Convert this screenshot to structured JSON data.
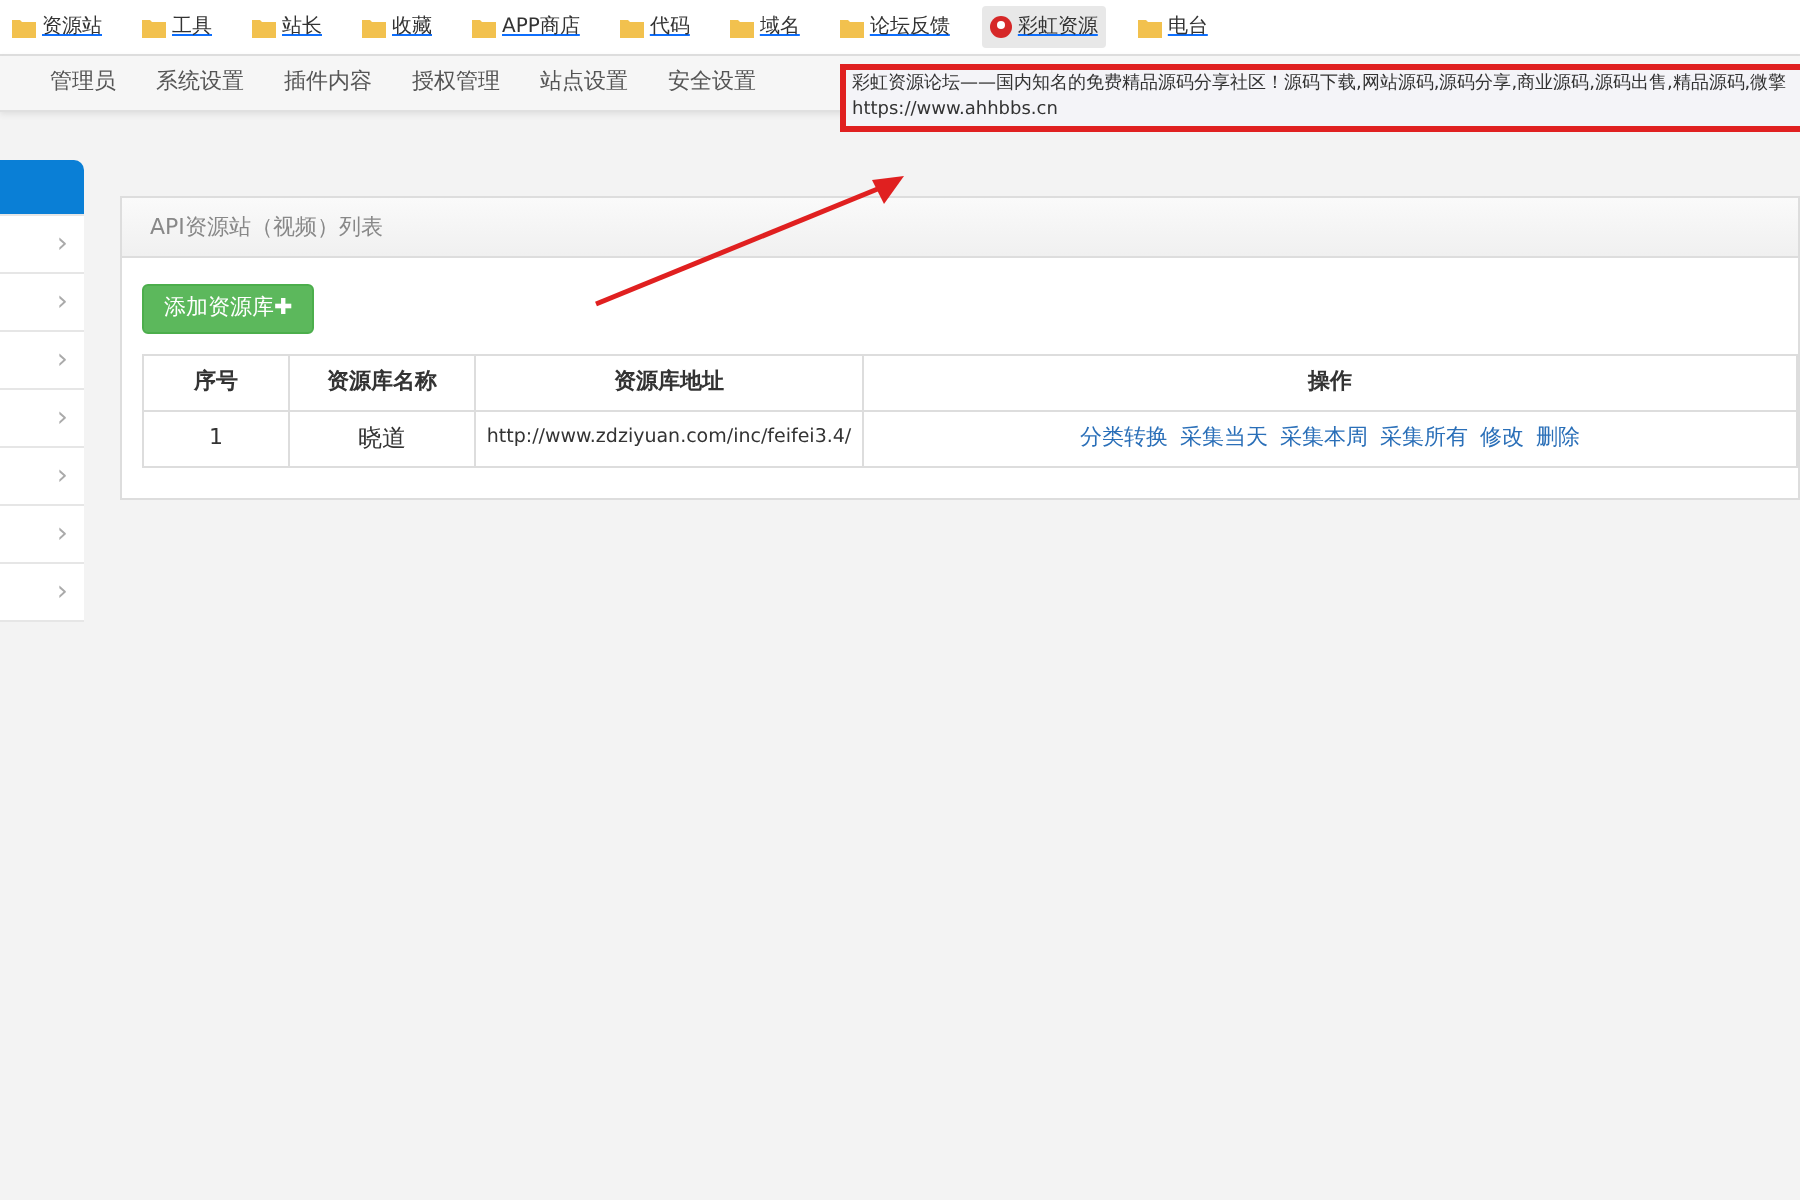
{
  "bookmarks": [
    {
      "kind": "folder",
      "label": "资源站"
    },
    {
      "kind": "folder",
      "label": "工具"
    },
    {
      "kind": "folder",
      "label": "站长"
    },
    {
      "kind": "folder",
      "label": "收藏"
    },
    {
      "kind": "folder",
      "label": "APP商店"
    },
    {
      "kind": "folder",
      "label": "代码"
    },
    {
      "kind": "folder",
      "label": "域名"
    },
    {
      "kind": "folder",
      "label": "论坛反馈"
    },
    {
      "kind": "site",
      "label": "彩虹资源"
    },
    {
      "kind": "folder",
      "label": "电台"
    }
  ],
  "nav": [
    "管理员",
    "系统设置",
    "插件内容",
    "授权管理",
    "站点设置",
    "安全设置"
  ],
  "tooltip": {
    "lines": [
      "彩虹资源论坛——国内知名的免费精品源码分享社区！源码下载,网站源码,源码分享,商业源码,源码出售,精品源码,微擎",
      "https://www.ahhbbs.cn"
    ]
  },
  "sidebar": {
    "items": [
      {
        "selected": true
      },
      {
        "selected": false,
        "arrow": "›"
      },
      {
        "selected": false,
        "arrow": "›"
      },
      {
        "selected": false,
        "arrow": "›"
      },
      {
        "selected": false,
        "arrow": "›"
      },
      {
        "selected": false,
        "arrow": "›"
      },
      {
        "selected": false,
        "arrow": "›"
      },
      {
        "selected": false,
        "arrow": "›"
      }
    ]
  },
  "panel": {
    "title": "API资源站（视频）列表",
    "add_button": "添加资源库✚",
    "table": {
      "columns": [
        "序号",
        "资源库名称",
        "资源库地址",
        "操作"
      ],
      "rows": [
        {
          "cells": [
            "1",
            "晓道",
            "http://www.zdziyuan.com/inc/feifei3.4/"
          ],
          "actions": [
            "分类转换",
            "采集当天",
            "采集本周",
            "采集所有",
            "修改",
            "删除"
          ]
        }
      ]
    }
  },
  "annotation": {
    "kind": "arrow"
  }
}
